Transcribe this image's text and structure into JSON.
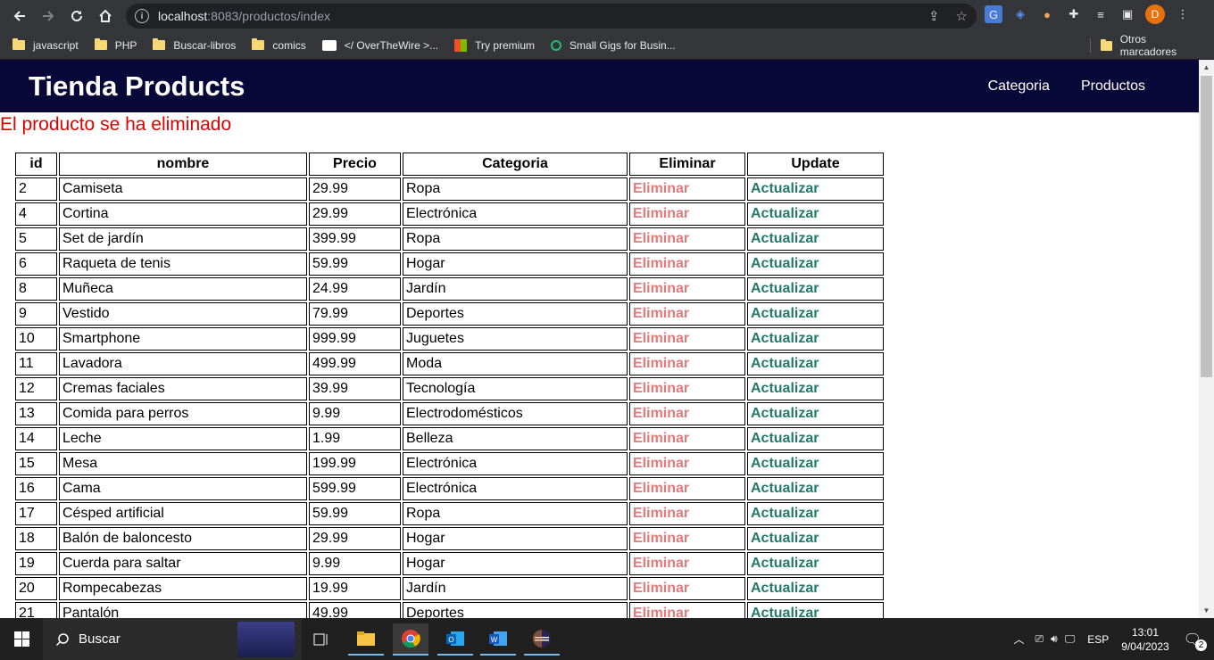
{
  "browser": {
    "url_host": "localhost",
    "url_rest": ":8083/productos/index",
    "profile_initial": "D",
    "bookmarks": [
      "javascript",
      "PHP",
      "Buscar-libros",
      "comics",
      "</ OverTheWire >...",
      "Try premium",
      "Small Gigs for Busin..."
    ],
    "other_bookmarks": "Otros marcadores"
  },
  "header": {
    "brand": "Tienda Products",
    "menu": [
      "Categoria",
      "Productos"
    ]
  },
  "message": "El producto se ha eliminado",
  "table": {
    "headers": [
      "id",
      "nombre",
      "Precio",
      "Categoria",
      "Eliminar",
      "Update"
    ],
    "delete_label": "Eliminar",
    "update_label": "Actualizar",
    "rows": [
      {
        "id": "2",
        "nombre": "Camiseta",
        "precio": "29.99",
        "categoria": "Ropa"
      },
      {
        "id": "4",
        "nombre": "Cortina",
        "precio": "29.99",
        "categoria": "Electrónica"
      },
      {
        "id": "5",
        "nombre": "Set de jardín",
        "precio": "399.99",
        "categoria": "Ropa"
      },
      {
        "id": "6",
        "nombre": "Raqueta de tenis",
        "precio": "59.99",
        "categoria": "Hogar"
      },
      {
        "id": "8",
        "nombre": "Muñeca",
        "precio": "24.99",
        "categoria": "Jardín"
      },
      {
        "id": "9",
        "nombre": "Vestido",
        "precio": "79.99",
        "categoria": "Deportes"
      },
      {
        "id": "10",
        "nombre": "Smartphone",
        "precio": "999.99",
        "categoria": "Juguetes"
      },
      {
        "id": "11",
        "nombre": "Lavadora",
        "precio": "499.99",
        "categoria": "Moda"
      },
      {
        "id": "12",
        "nombre": "Cremas faciales",
        "precio": "39.99",
        "categoria": "Tecnología"
      },
      {
        "id": "13",
        "nombre": "Comida para perros",
        "precio": "9.99",
        "categoria": "Electrodomésticos"
      },
      {
        "id": "14",
        "nombre": "Leche",
        "precio": "1.99",
        "categoria": "Belleza"
      },
      {
        "id": "15",
        "nombre": "Mesa",
        "precio": "199.99",
        "categoria": "Electrónica"
      },
      {
        "id": "16",
        "nombre": "Cama",
        "precio": "599.99",
        "categoria": "Electrónica"
      },
      {
        "id": "17",
        "nombre": "Césped artificial",
        "precio": "59.99",
        "categoria": "Ropa"
      },
      {
        "id": "18",
        "nombre": "Balón de baloncesto",
        "precio": "29.99",
        "categoria": "Hogar"
      },
      {
        "id": "19",
        "nombre": "Cuerda para saltar",
        "precio": "9.99",
        "categoria": "Hogar"
      },
      {
        "id": "20",
        "nombre": "Rompecabezas",
        "precio": "19.99",
        "categoria": "Jardín"
      },
      {
        "id": "21",
        "nombre": "Pantalón",
        "precio": "49.99",
        "categoria": "Deportes"
      }
    ]
  },
  "taskbar": {
    "search_placeholder": "Buscar",
    "language": "ESP",
    "time": "13:01",
    "date": "9/04/2023",
    "notification_count": "2"
  }
}
